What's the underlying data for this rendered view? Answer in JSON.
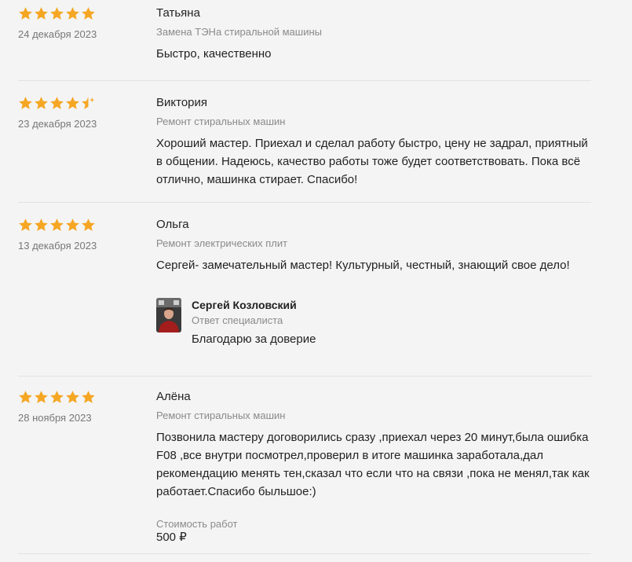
{
  "colors": {
    "star": "#F5A623",
    "muted": "#8a8a8a",
    "text": "#222222",
    "divider": "#e2e2e2"
  },
  "reviews": [
    {
      "rating": 5,
      "date": "24 декабря 2023",
      "author": "Татьяна",
      "service": "Замена ТЭНа стиральной машины",
      "text": "Быстро, качественно"
    },
    {
      "rating": 4.5,
      "date": "23 декабря 2023",
      "author": "Виктория",
      "service": "Ремонт стиральных машин",
      "text": "Хороший мастер. Приехал и сделал работу быстро, цену не задрал, приятный в общении. Надеюсь, качество работы тоже будет соответствовать. Пока всё отлично, машинка стирает. Спасибо!"
    },
    {
      "rating": 5,
      "date": "13 декабря 2023",
      "author": "Ольга",
      "service": "Ремонт электрических плит",
      "text": "Сергей- замечательный мастер! Культурный, честный, знающий свое дело!",
      "reply": {
        "name": "Сергей Козловский",
        "role": "Ответ специалиста",
        "text": "Благодарю за доверие"
      }
    },
    {
      "rating": 5,
      "date": "28 ноября 2023",
      "author": "Алёна",
      "service": "Ремонт стиральных машин",
      "text": "Позвонила мастеру договорились сразу ,приехал через 20 минут,была ошибка F08 ,все внутри посмотрел,проверил в итоге машинка заработала,дал рекомендацию менять тен,сказал что если что на связи ,пока не менял,так как работает.Спасибо быльшое:)",
      "cost": {
        "label": "Стоимость работ",
        "value": "500 ₽"
      }
    }
  ]
}
